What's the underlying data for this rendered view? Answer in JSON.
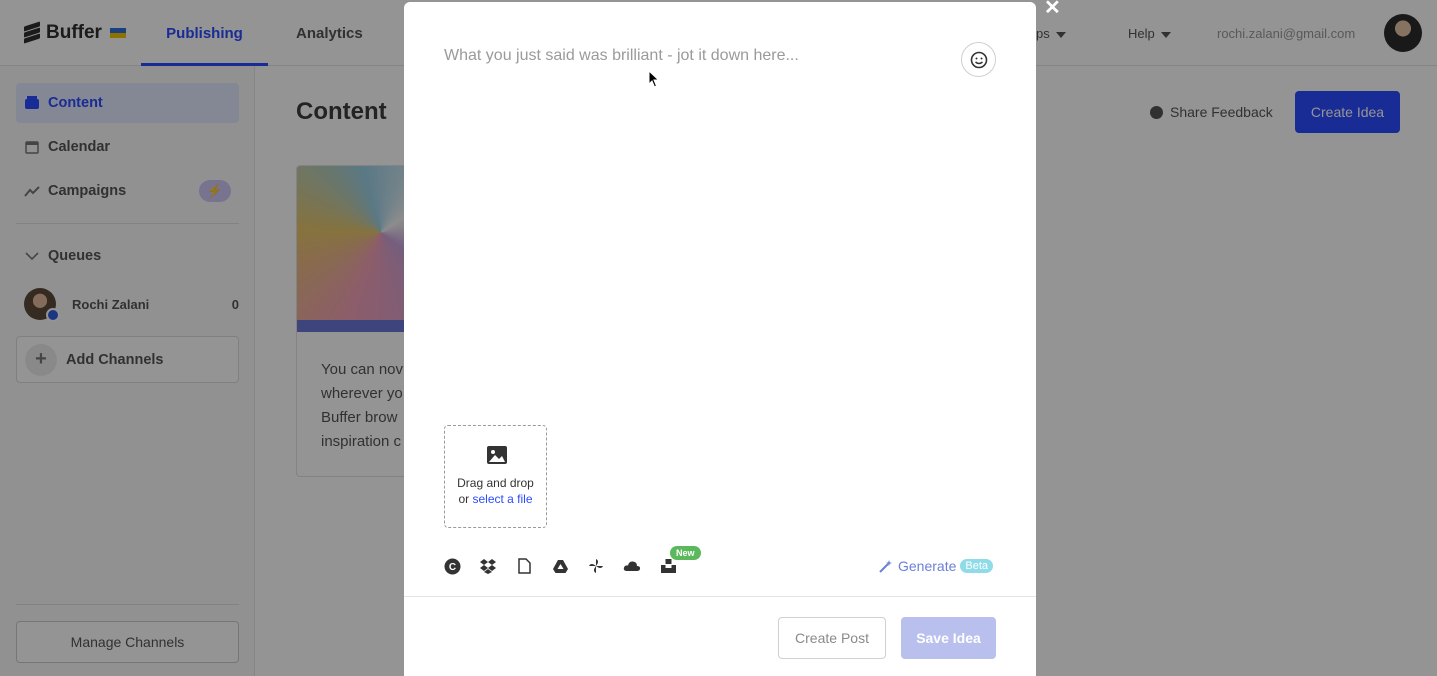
{
  "app": {
    "brand": "Buffer",
    "brand_color": "#2c4bff"
  },
  "topnav": {
    "tabs": [
      {
        "label": "Publishing",
        "active": true
      },
      {
        "label": "Analytics",
        "active": false
      }
    ],
    "apps_fragment": "ps",
    "help": "Help",
    "email": "rochi.zalani@gmail.com"
  },
  "sidebar": {
    "items": [
      {
        "label": "Content",
        "icon": "inbox-icon",
        "active": true
      },
      {
        "label": "Calendar",
        "icon": "calendar-icon",
        "active": false
      },
      {
        "label": "Campaigns",
        "icon": "trend-icon",
        "active": false,
        "badge": "⚡"
      }
    ],
    "queues_label": "Queues",
    "channel": {
      "name": "Rochi Zalani",
      "count": "0"
    },
    "add_channels": "Add Channels",
    "manage_channels": "Manage Channels"
  },
  "main": {
    "title": "Content",
    "share_feedback": "Share Feedback",
    "create_idea": "Create Idea",
    "card_lines": [
      "You can nov",
      "wherever yo",
      "Buffer brow",
      "inspiration c"
    ]
  },
  "modal": {
    "close": "✕",
    "placeholder": "What you just said was brilliant - jot it down here...",
    "dropzone": {
      "line1": "Drag and drop",
      "line2_prefix": "or ",
      "link": "select a file"
    },
    "tools": [
      "canva-icon",
      "dropbox-icon",
      "file-icon",
      "google-drive-icon",
      "pinwheel-icon",
      "cloud-icon",
      "unsplash-icon"
    ],
    "new_badge": "New",
    "generate": "Generate",
    "beta": "Beta",
    "create_post": "Create Post",
    "save_idea": "Save Idea"
  }
}
